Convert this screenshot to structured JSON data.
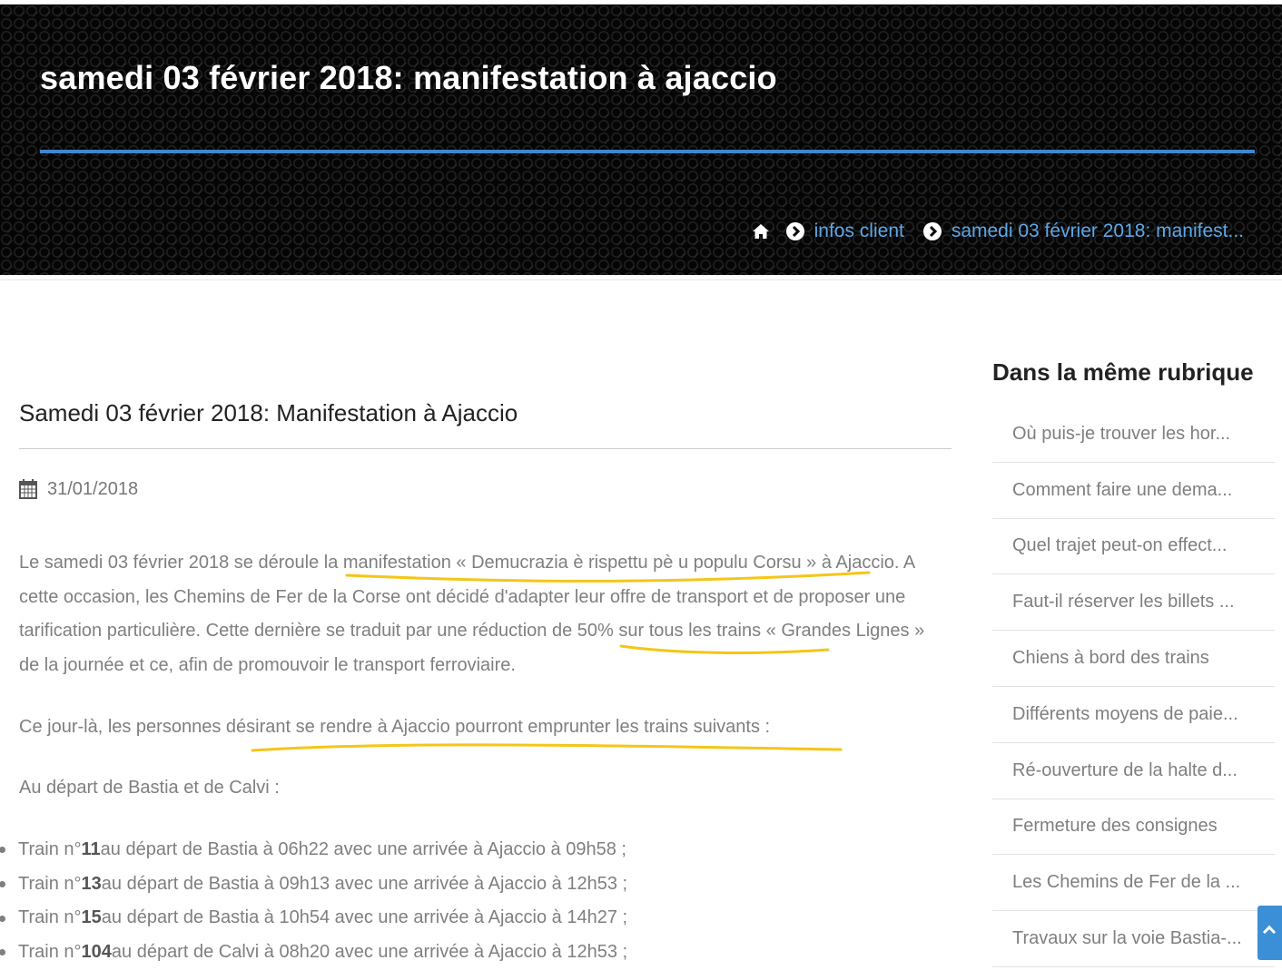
{
  "hero": {
    "title": "samedi 03 février 2018: manifestation à ajaccio"
  },
  "breadcrumb": {
    "home_icon": "home-icon",
    "items": [
      {
        "label": "infos client",
        "icon": "chevron-right-circle-icon"
      },
      {
        "label": "samedi 03 février 2018: manifest...",
        "icon": "chevron-right-circle-icon"
      }
    ]
  },
  "article": {
    "title": "Samedi 03 février 2018: Manifestation à Ajaccio",
    "date_icon": "calendar-icon",
    "date": "31/01/2018",
    "paragraph1": "Le samedi 03 février 2018 se déroule la manifestation « Demucrazia è rispettu pè u populu Corsu » à Ajaccio. A cette occasion, les Chemins de Fer de la Corse ont décidé d'adapter leur offre de transport et de proposer une tarification particulière. Cette dernière se traduit par une réduction de 50% sur tous les trains « Grandes Lignes » de la journée et ce, afin de promouvoir le transport ferroviaire.",
    "paragraph2": "Ce jour-là, les personnes désirant se rendre à Ajaccio pourront emprunter les trains suivants :",
    "paragraph3": "Au départ de Bastia et de Calvi :",
    "trains": [
      {
        "prefix": "Train n°",
        "number": "11",
        "rest": " au départ de Bastia à 06h22 avec une arrivée à Ajaccio à 09h58 ;"
      },
      {
        "prefix": "Train n°",
        "number": "13",
        "rest": " au départ de Bastia à 09h13 avec une arrivée à Ajaccio à 12h53 ;"
      },
      {
        "prefix": "Train n°",
        "number": "15",
        "rest": " au départ de Bastia à 10h54 avec une arrivée à Ajaccio à 14h27 ;"
      },
      {
        "prefix": "Train n°",
        "number": "104",
        "rest": " au départ de Calvi à 08h20 avec une arrivée à Ajaccio à 12h53 ;"
      }
    ],
    "highlight_color": "#f5c518"
  },
  "sidebar": {
    "title": "Dans la même rubrique",
    "items": [
      {
        "label": "Où puis-je trouver les hor..."
      },
      {
        "label": "Comment faire une dema..."
      },
      {
        "label": "Quel trajet peut-on effect..."
      },
      {
        "label": "Faut-il réserver les billets ..."
      },
      {
        "label": "Chiens à bord des trains"
      },
      {
        "label": "Différents moyens de paie..."
      },
      {
        "label": "Ré-ouverture de la halte d..."
      },
      {
        "label": "Fermeture des consignes"
      },
      {
        "label": "Les Chemins de Fer de la ..."
      },
      {
        "label": "Travaux sur la voie Bastia-..."
      }
    ]
  },
  "colors": {
    "accent": "#3f86cf",
    "link": "#5ea7e6",
    "body_text": "#7f7f7f",
    "hero_bg": "#050505"
  },
  "scroll_top_icon": "arrow-up-icon"
}
